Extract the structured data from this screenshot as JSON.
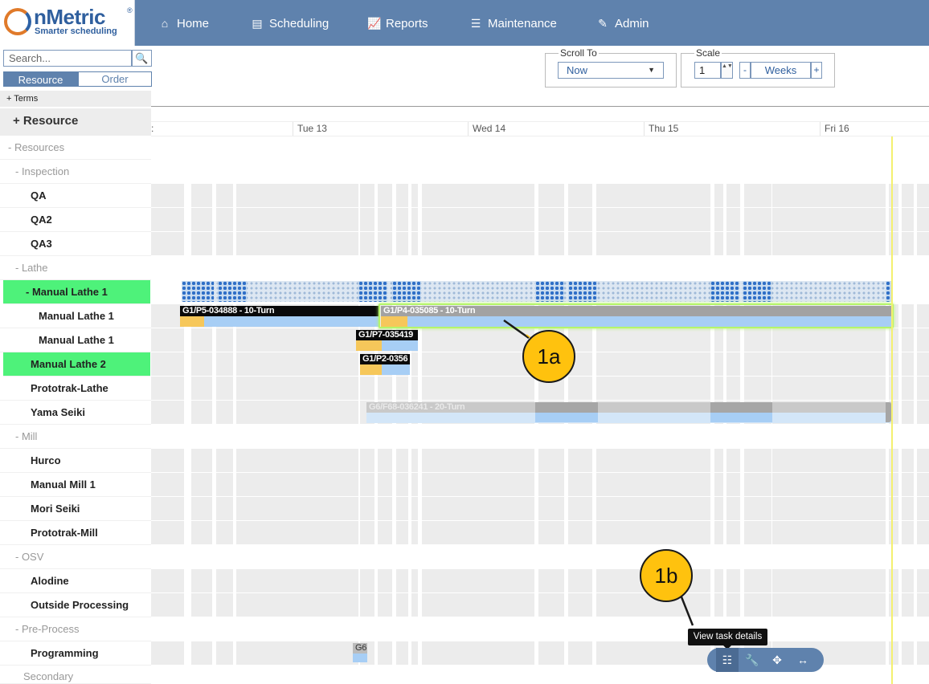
{
  "nav": {
    "logo_text": "nMetric",
    "logo_reg": "®",
    "logo_tagline": "Smarter scheduling",
    "items": [
      {
        "label": "Home",
        "icon": "home-icon",
        "glyph": "⌂"
      },
      {
        "label": "Scheduling",
        "icon": "scheduling-icon",
        "glyph": "▤"
      },
      {
        "label": "Reports",
        "icon": "chart-icon",
        "glyph": "📈"
      },
      {
        "label": "Maintenance",
        "icon": "sliders-icon",
        "glyph": "☰"
      },
      {
        "label": "Admin",
        "icon": "edit-icon",
        "glyph": "✎"
      }
    ]
  },
  "sidebar": {
    "search_placeholder": "Search...",
    "search_glyph": "🔍",
    "tab_resource": "Resource",
    "tab_order": "Order",
    "terms_label": "+  Terms",
    "resource_header": "+ Resource",
    "rows": [
      {
        "label": "- Resources",
        "kind": "group"
      },
      {
        "label": "- Inspection",
        "kind": "group"
      },
      {
        "label": "QA",
        "kind": "res"
      },
      {
        "label": "QA2",
        "kind": "res"
      },
      {
        "label": "QA3",
        "kind": "res"
      },
      {
        "label": "- Lathe",
        "kind": "group"
      },
      {
        "label": "- Manual Lathe 1",
        "kind": "res",
        "highlight": true
      },
      {
        "label": "Manual Lathe 1",
        "kind": "res"
      },
      {
        "label": "Manual Lathe 1",
        "kind": "res"
      },
      {
        "label": "Manual Lathe 2",
        "kind": "res",
        "highlight": true
      },
      {
        "label": "Prototrak-Lathe",
        "kind": "res"
      },
      {
        "label": "Yama Seiki",
        "kind": "res"
      },
      {
        "label": "- Mill",
        "kind": "group"
      },
      {
        "label": "Hurco",
        "kind": "res"
      },
      {
        "label": "Manual Mill 1",
        "kind": "res"
      },
      {
        "label": "Mori Seiki",
        "kind": "res"
      },
      {
        "label": "Prototrak-Mill",
        "kind": "res"
      },
      {
        "label": "- OSV",
        "kind": "group"
      },
      {
        "label": "Alodine",
        "kind": "res"
      },
      {
        "label": "Outside Processing",
        "kind": "res"
      },
      {
        "label": "- Pre-Process",
        "kind": "group"
      },
      {
        "label": "Programming",
        "kind": "res"
      },
      {
        "label": "Secondary",
        "kind": "group"
      }
    ]
  },
  "toolbar": {
    "scroll_to_legend": "Scroll To",
    "scroll_to_value": "Now",
    "scale_legend": "Scale",
    "scale_value": "1",
    "scale_minus": "-",
    "scale_unit": "Weeks",
    "scale_plus": "+",
    "spin_glyph": "▲▼"
  },
  "gantt": {
    "partial_label": ":",
    "dates": [
      "Tue 13",
      "Wed 14",
      "Thu 15",
      "Fri 16"
    ],
    "tasks": [
      {
        "label": "G1/P5-034888 - 10-Turn"
      },
      {
        "label": "G1/P4-035085 - 10-Turn"
      },
      {
        "label": "G1/P7-035419"
      },
      {
        "label": "G1/P2-0356"
      },
      {
        "label": "G6/F68-036241 - 20-Turn"
      },
      {
        "label": "G6"
      }
    ]
  },
  "callouts": {
    "a": "1a",
    "b": "1b"
  },
  "tooltip": "View task details",
  "fab": [
    {
      "icon": "list-details-icon",
      "glyph": "☷"
    },
    {
      "icon": "wrench-icon",
      "glyph": "🔧"
    },
    {
      "icon": "move-icon",
      "glyph": "✥"
    },
    {
      "icon": "resize-horizontal-icon",
      "glyph": "↔"
    }
  ]
}
